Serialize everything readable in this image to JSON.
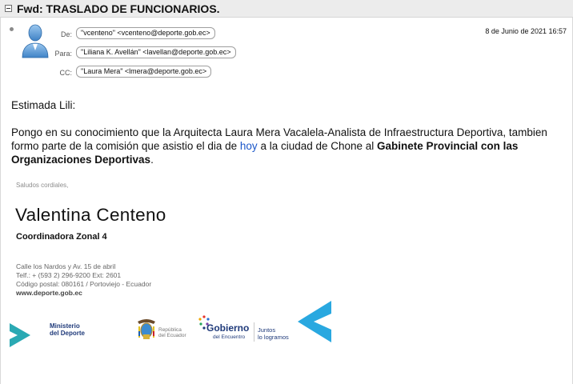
{
  "email": {
    "subject": "Fwd: TRASLADO DE FUNCIONARIOS.",
    "date": "8 de Junio de 2021 16:57",
    "headers": {
      "from_label": "De:",
      "from_value": "\"vcenteno\" <vcenteno@deporte.gob.ec>",
      "to_label": "Para:",
      "to_value": "\"Liliana K. Avellán\" <lavellan@deporte.gob.ec>",
      "cc_label": "CC:",
      "cc_value": "\"Laura Mera\" <lmera@deporte.gob.ec>"
    },
    "body": {
      "greeting": "Estimada Lili:",
      "p1_part1": "Pongo en su conocimiento que la Arquitecta Laura Mera Vacalela-Analista de Infraestructura Deportiva, tambien formo parte de la comisión que asistio el dia de ",
      "p1_link": "hoy",
      "p1_part2": " a la ciudad de Chone al ",
      "p1_bold": "Gabinete Provincial con las Organizaciones Deportivas",
      "p1_end": "."
    }
  },
  "signature": {
    "saludos": "Saludos cordiales,",
    "name": "Valentina Centeno",
    "role": "Coordinadora Zonal 4",
    "address_1": "Calle los Nardos y Av. 15 de abril",
    "address_2": "Telf.: + (593 2) 296-9200 Ext: 2601",
    "address_3": "Código postal: 080161 / Portoviejo - Ecuador",
    "website": "www.deporte.gob.ec"
  },
  "logos": {
    "ministerio_1": "Ministerio",
    "ministerio_2": "del Deporte",
    "republica_1": "República",
    "republica_2": "del Ecuador",
    "gobierno_1": "Gobierno",
    "gobierno_2": "del Encuentro",
    "juntos_1": "Juntos",
    "juntos_2": "lo logramos"
  },
  "colors": {
    "teal": "#2aa9b3",
    "ministerio_blue": "#1f3a7a",
    "cyan_chevron": "#29a8e0",
    "link": "#1a56c9"
  }
}
